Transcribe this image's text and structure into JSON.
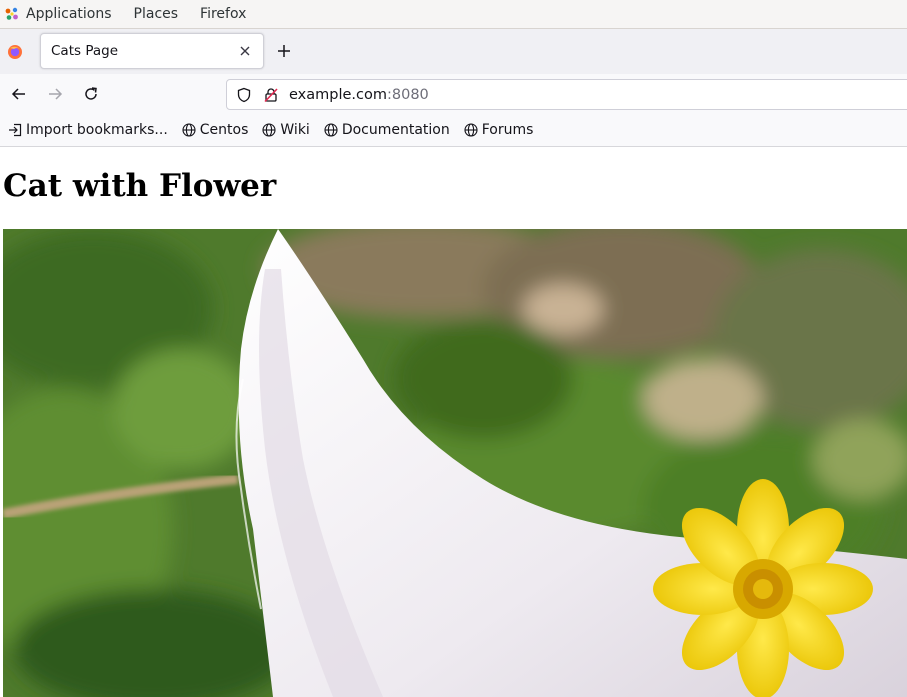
{
  "gnome_bar": {
    "applications": "Applications",
    "places": "Places",
    "firefox": "Firefox"
  },
  "tabs": [
    {
      "title": "Cats Page",
      "active": true
    }
  ],
  "navbar": {
    "url_host": "example.com",
    "url_port": ":8080"
  },
  "bookmarks": [
    {
      "label": "Import bookmarks...",
      "icon": "import-icon"
    },
    {
      "label": "Centos",
      "icon": "globe-icon"
    },
    {
      "label": "Wiki",
      "icon": "globe-icon"
    },
    {
      "label": "Documentation",
      "icon": "globe-icon"
    },
    {
      "label": "Forums",
      "icon": "globe-icon"
    }
  ],
  "page": {
    "heading": "Cat with Flower"
  },
  "colors": {
    "grass": "#5b7a34",
    "fur": "#f1eff4",
    "flower": "#f5d60a"
  }
}
